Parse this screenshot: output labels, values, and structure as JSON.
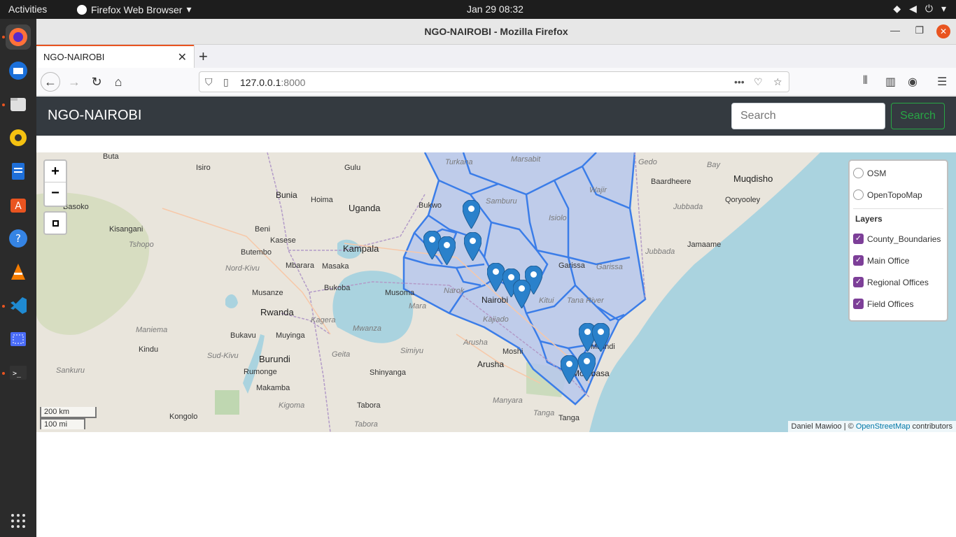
{
  "system": {
    "activities": "Activities",
    "app_name": "Firefox Web Browser",
    "clock": "Jan 29  08:32"
  },
  "window": {
    "title": "NGO-NAIROBI - Mozilla Firefox",
    "tab_title": "NGO-NAIROBI",
    "url_host": "127.0.0.1",
    "url_port": ":8000"
  },
  "page": {
    "brand": "NGO-NAIROBI",
    "search_placeholder": "Search",
    "search_button": "Search"
  },
  "map": {
    "zoom_in": "+",
    "zoom_out": "−",
    "scale_km": "200 km",
    "scale_mi": "100 mi",
    "attribution_author": "Daniel Mawioo | © ",
    "attribution_link": "OpenStreetMap",
    "attribution_suffix": " contributors",
    "basemaps": [
      "OSM",
      "OpenTopoMap"
    ],
    "layers_header": "Layers",
    "overlays": [
      "County_Boundaries",
      "Main Office",
      "Regional Offices",
      "Field Offices"
    ],
    "places": {
      "buta": "Buta",
      "isiro": "Isiro",
      "gulu": "Gulu",
      "bunia": "Bunia",
      "hoima": "Hoima",
      "uganda": "Uganda",
      "basoko": "Basoko",
      "kisangani": "Kisangani",
      "tshopo": "Tshopo",
      "beni": "Beni",
      "kasese": "Kasese",
      "butembo": "Butembo",
      "kampala": "Kampala",
      "mbarara": "Mbarara",
      "masaka": "Masaka",
      "nord_kivu": "Nord-Kivu",
      "bukoba": "Bukoba",
      "musoma": "Musoma",
      "musanze": "Musanze",
      "rwanda": "Rwanda",
      "kagera": "Kagera",
      "mwanza": "Mwanza",
      "mara": "Mara",
      "narok": "Narok",
      "nairobi": "Nairobi",
      "kajiado": "Kajiado",
      "kitui": "Kitui",
      "tana_river": "Tana River",
      "garissa": "Garissa",
      "garissa2": "Garissa",
      "isiolo": "Isiolo",
      "wajir": "Wajir",
      "marsabit": "Marsabit",
      "turkana": "Turkana",
      "samburu": "Samburu",
      "bukwo": "Bukwo",
      "maniema": "Maniema",
      "kindu": "Kindu",
      "bukavu": "Bukavu",
      "muyinga": "Muyinga",
      "sud_kivu": "Sud-Kivu",
      "burundi": "Burundi",
      "geita": "Geita",
      "simiyu": "Simiyu",
      "arusha_region": "Arusha",
      "arusha": "Arusha",
      "moshi": "Moshi",
      "shinyanga": "Shinyanga",
      "rumonge": "Rumonge",
      "makamba": "Makamba",
      "sankuru": "Sankuru",
      "kigoma": "Kigoma",
      "tabora": "Tabora",
      "tabora2": "Tabora",
      "manyara": "Manyara",
      "tanga": "Tanga",
      "tanga2": "Tanga",
      "kongolo": "Kongolo",
      "malindi": "Malindi",
      "mombasa": "Mombasa",
      "gedo": "Gedo",
      "bay": "Bay",
      "baardheere": "Baardheere",
      "muqdisho": "Muqdisho",
      "qoryooley": "Qoryooley",
      "jubbada_dhexe": "Jubbada",
      "jamaame": "Jamaame",
      "jubbada_hoose": "Jubbada"
    }
  }
}
